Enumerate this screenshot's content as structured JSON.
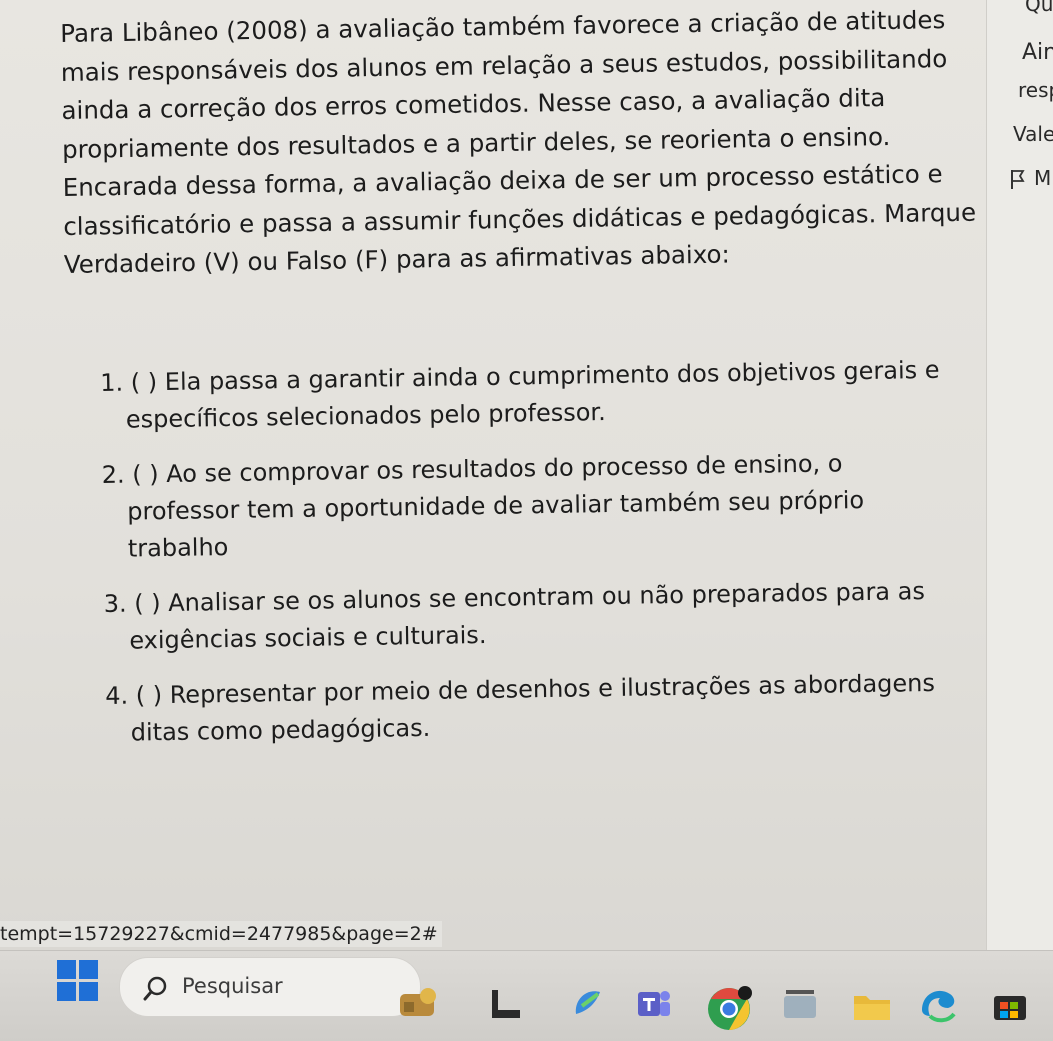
{
  "question": {
    "statement_lines": [
      "Para Libâneo (2008) a avaliação também favorece a criação de atitudes",
      "mais responsáveis dos alunos em relação a seus estudos, possibilitando",
      "ainda a correção dos erros cometidos. Nesse caso, a avaliação dita",
      "propriamente dos resultados e a partir deles, se reorienta o ensino.",
      "Encarada dessa forma, a avaliação deixa de ser um processo estático e",
      "classificatório e passa a assumir funções didáticas e pedagógicas. Marque",
      "Verdadeiro (V) ou Falso (F) para as afirmativas abaixo:"
    ],
    "items": [
      {
        "lines": [
          "1. (  ) Ela passa a garantir ainda o cumprimento dos objetivos gerais e",
          "específicos selecionados pelo professor."
        ]
      },
      {
        "lines": [
          "2. (  ) Ao se comprovar os resultados do processo de ensino, o",
          "professor tem a oportunidade de avaliar também seu próprio",
          "trabalho"
        ]
      },
      {
        "lines": [
          "3. (   ) Analisar se os alunos se encontram ou não preparados para as",
          "exigências sociais e culturais."
        ]
      },
      {
        "lines": [
          "4. (  ) Representar por meio de desenhos e ilustrações as abordagens",
          "ditas como pedagógicas."
        ]
      }
    ]
  },
  "side_panel": {
    "top_fragment": "Qu",
    "line1": "Ain",
    "line2": "resp",
    "line3": "Vale",
    "flag_text": "M"
  },
  "status_bar": {
    "url_fragment": "tempt=15729227&cmid=2477985&page=2#"
  },
  "taskbar": {
    "search_placeholder": "Pesquisar",
    "icons": [
      "widgets-icon",
      "file-explorer-icon",
      "photos-icon",
      "teams-icon",
      "chrome-icon",
      "amazon-icon",
      "folder-icon",
      "edge-icon",
      "store-icon"
    ]
  },
  "colors": {
    "screen_bg": "#e4e2dd",
    "text": "#1c1c1c",
    "windows_blue": "#1f6fd6",
    "taskbar_bg": "#d6d4d0"
  }
}
